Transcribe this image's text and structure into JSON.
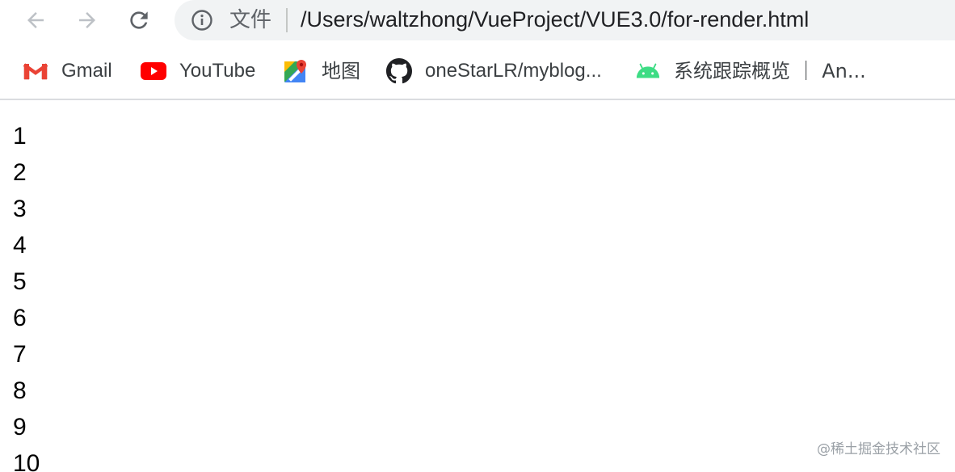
{
  "toolbar": {
    "back_icon": "arrow-left-icon",
    "forward_icon": "arrow-right-icon",
    "reload_icon": "reload-icon"
  },
  "omnibox": {
    "info_icon": "info-icon",
    "scheme_label": "文件",
    "url": "/Users/waltzhong/VueProject/VUE3.0/for-render.html"
  },
  "bookmarks": [
    {
      "label": "Gmail",
      "icon": "gmail-icon"
    },
    {
      "label": "YouTube",
      "icon": "youtube-icon"
    },
    {
      "label": "地图",
      "icon": "maps-icon"
    },
    {
      "label": "oneStarLR/myblog...",
      "icon": "github-icon"
    },
    {
      "label": "系统跟踪概览 ｜ An...",
      "icon": "android-icon"
    }
  ],
  "content": {
    "items": [
      "1",
      "2",
      "3",
      "4",
      "5",
      "6",
      "7",
      "8",
      "9",
      "10"
    ]
  },
  "watermark": "@稀土掘金技术社区",
  "colors": {
    "omnibox_bg": "#f1f3f4",
    "nav_icon": "#5f6368",
    "nav_icon_disabled": "#bdc1c6",
    "youtube_red": "#ff0000",
    "android_green": "#3ddc84"
  }
}
